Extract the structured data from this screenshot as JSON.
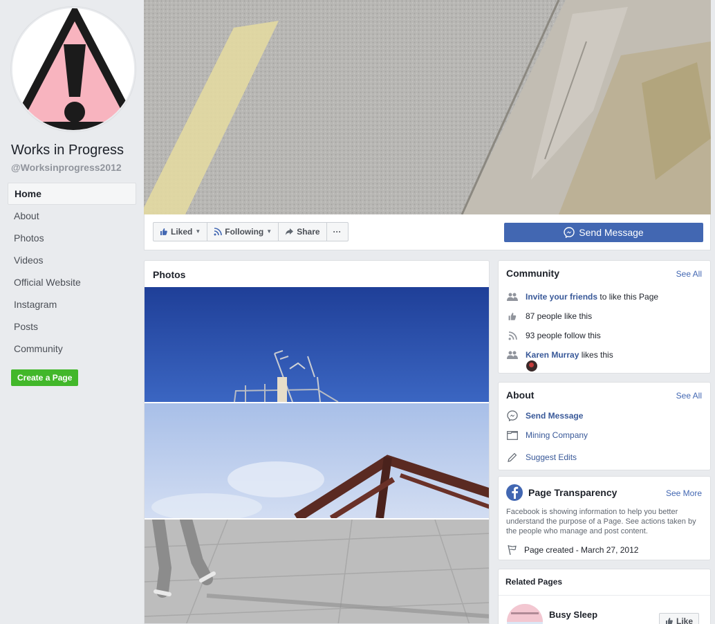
{
  "sidebar": {
    "page_name": "Works in Progress",
    "page_handle": "@Worksinprogress2012",
    "nav": [
      "Home",
      "About",
      "Photos",
      "Videos",
      "Official Website",
      "Instagram",
      "Posts",
      "Community"
    ],
    "create_page": "Create a Page"
  },
  "actionbar": {
    "liked": "Liked",
    "following": "Following",
    "share": "Share",
    "more": "···",
    "send_message": "Send Message"
  },
  "photos": {
    "title": "Photos"
  },
  "community": {
    "title": "Community",
    "see_all": "See All",
    "invite_link": "Invite your friends",
    "invite_rest": " to like this Page",
    "likes": "87 people like this",
    "follows": "93 people follow this",
    "friend_name": "Karen Murray",
    "friend_rest": " likes this"
  },
  "about": {
    "title": "About",
    "see_all": "See All",
    "send_message": "Send Message",
    "category": "Mining Company",
    "suggest": "Suggest Edits"
  },
  "transparency": {
    "title": "Page Transparency",
    "see_more": "See More",
    "description": "Facebook is showing information to help you better understand the purpose of a Page. See actions taken by the people who manage and post content.",
    "created": "Page created - March 27, 2012"
  },
  "related": {
    "title": "Related Pages",
    "page_name": "Busy Sleep",
    "like": "Like"
  },
  "colors": {
    "accent": "#4267b2",
    "create_green": "#42b72a",
    "link": "#385898"
  }
}
